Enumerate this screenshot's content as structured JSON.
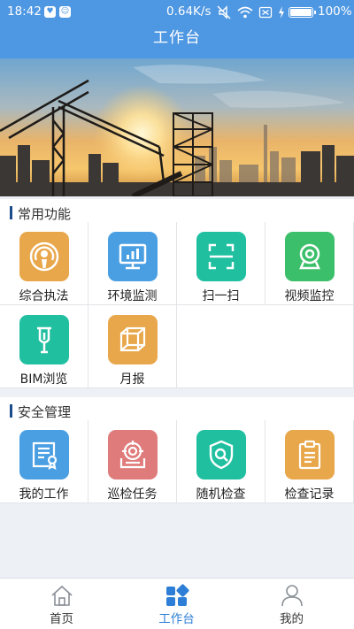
{
  "status_bar": {
    "time": "18:42",
    "network_speed": "0.64K/s",
    "battery_percent": "100%",
    "icons": [
      "shield-icon",
      "android-icon",
      "mute-icon",
      "wifi-icon",
      "sim-icon",
      "charging-icon",
      "battery-icon"
    ]
  },
  "header": {
    "title": "工作台"
  },
  "banner": {
    "image": "construction-site-sunset-banner"
  },
  "sections": [
    {
      "title": "常用功能",
      "items": [
        {
          "label": "综合执法",
          "icon": "podcast-icon",
          "color": "#e8a74a"
        },
        {
          "label": "环境监测",
          "icon": "monitor-chart-icon",
          "color": "#4a9fe3"
        },
        {
          "label": "扫一扫",
          "icon": "scan-icon",
          "color": "#1fbfa0"
        },
        {
          "label": "视频监控",
          "icon": "webcam-icon",
          "color": "#3cbf6a"
        },
        {
          "label": "BIM浏览",
          "icon": "bim-icon",
          "color": "#1fbfa0"
        },
        {
          "label": "月报",
          "icon": "cube-icon",
          "color": "#e8a74a"
        }
      ]
    },
    {
      "title": "安全管理",
      "items": [
        {
          "label": "我的工作",
          "icon": "certificate-icon",
          "color": "#4a9fe3"
        },
        {
          "label": "巡检任务",
          "icon": "target-box-icon",
          "color": "#e07b7b"
        },
        {
          "label": "随机检查",
          "icon": "shield-search-icon",
          "color": "#1fbfa0"
        },
        {
          "label": "检查记录",
          "icon": "clipboard-icon",
          "color": "#e8a74a"
        }
      ]
    }
  ],
  "tabbar": {
    "items": [
      {
        "label": "首页",
        "icon": "home-icon",
        "active": false
      },
      {
        "label": "工作台",
        "icon": "grid-icon",
        "active": true
      },
      {
        "label": "我的",
        "icon": "user-icon",
        "active": false
      }
    ],
    "active_color": "#2d7ed6"
  },
  "colors": {
    "primary": "#4e97e2",
    "section_bar": "#1d4c8c",
    "background": "#edf0f5"
  }
}
